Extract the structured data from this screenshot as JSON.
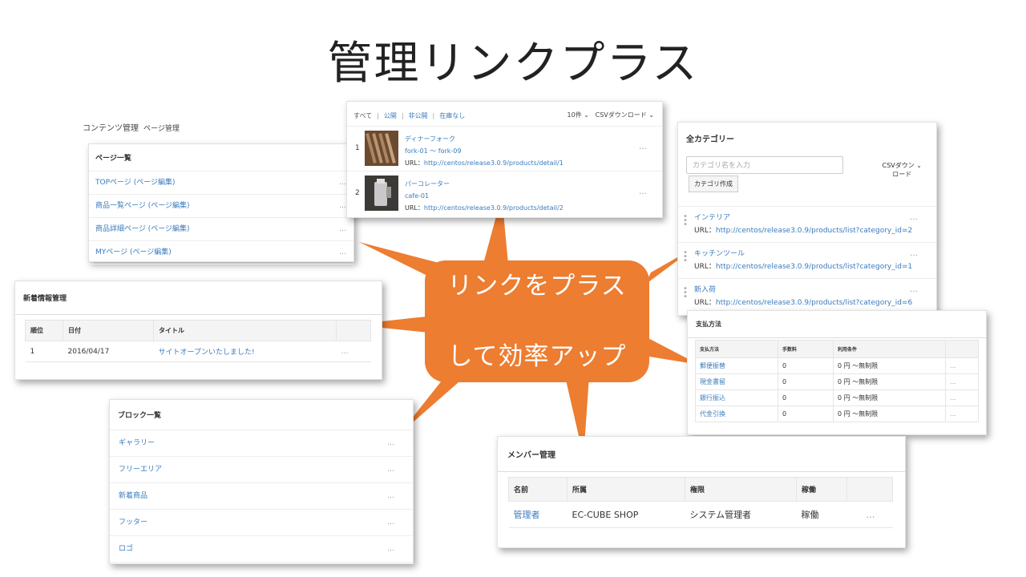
{
  "title": "管理リンクプラス",
  "callout": {
    "line1": "リンクをプラス",
    "line2": "して効率アップ",
    "color": "#ed7d31"
  },
  "dots": "…",
  "contents": {
    "breadcrumb": "コンテンツ管理",
    "breadcrumb_sub": "ページ管理",
    "header": "ページ一覧",
    "items": [
      "TOPページ (ページ編集)",
      "商品一覧ページ (ページ編集)",
      "商品詳細ページ (ページ編集)",
      "MYページ (ページ編集)"
    ]
  },
  "products": {
    "tabs": [
      "すべて",
      "公開",
      "非公開",
      "在庫なし"
    ],
    "per_page": "10件 ⌄",
    "csv": "CSVダウンロード ⌄",
    "rows": [
      {
        "num": "1",
        "name": "ディナーフォーク",
        "code": "fork-01 ～ fork-09",
        "url_label": "URL：",
        "url": "http://centos/release3.0.9/products/detail/1"
      },
      {
        "num": "2",
        "name": "パーコレーター",
        "code": "cafe-01",
        "url_label": "URL：",
        "url": "http://centos/release3.0.9/products/detail/2"
      }
    ]
  },
  "category": {
    "header": "全カテゴリー",
    "search_placeholder": "カテゴリ名を入力",
    "create_btn": "カテゴリ作成",
    "csv_line1": "CSVダウン ⌄",
    "csv_line2": "ロード",
    "url_label": "URL：",
    "rows": [
      {
        "name": "インテリア",
        "url": "http://centos/release3.0.9/products/list?category_id=2"
      },
      {
        "name": "キッチンツール",
        "url": "http://centos/release3.0.9/products/list?category_id=1"
      },
      {
        "name": "新入荷",
        "url": "http://centos/release3.0.9/products/list?category_id=6"
      }
    ]
  },
  "news": {
    "header": "新着情報管理",
    "columns": [
      "順位",
      "日付",
      "タイトル"
    ],
    "rows": [
      {
        "rank": "1",
        "date": "2016/04/17",
        "title": "サイトオープンいたしました!"
      }
    ]
  },
  "payment": {
    "header": "支払方法",
    "columns": [
      "支払方法",
      "手数料",
      "利用条件"
    ],
    "rows": [
      {
        "method": "郵便振替",
        "fee": "0",
        "cond": "0 円 ～無制限"
      },
      {
        "method": "現金書留",
        "fee": "0",
        "cond": "0 円 ～無制限"
      },
      {
        "method": "銀行振込",
        "fee": "0",
        "cond": "0 円 ～無制限"
      },
      {
        "method": "代金引換",
        "fee": "0",
        "cond": "0 円 ～無制限"
      }
    ]
  },
  "block": {
    "header": "ブロック一覧",
    "items": [
      "ギャラリー",
      "フリーエリア",
      "新着商品",
      "フッター",
      "ロゴ"
    ]
  },
  "member": {
    "header": "メンバー管理",
    "columns": [
      "名前",
      "所属",
      "権限",
      "稼働"
    ],
    "rows": [
      {
        "name": "管理者",
        "dept": "EC-CUBE SHOP",
        "role": "システム管理者",
        "status": "稼働"
      }
    ]
  }
}
